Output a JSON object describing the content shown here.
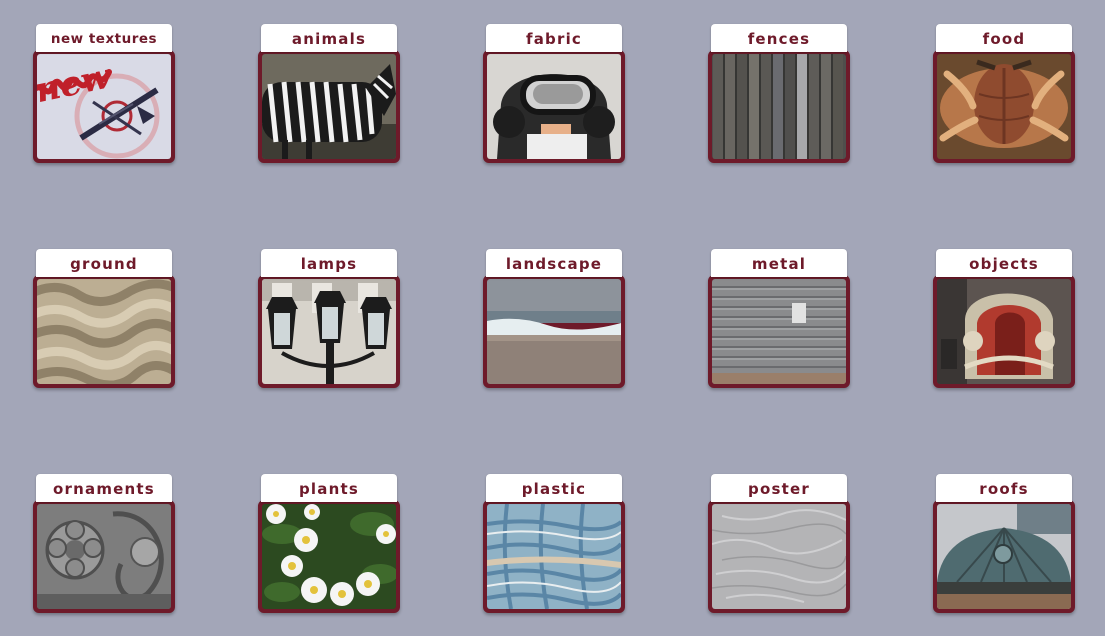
{
  "categories": [
    {
      "id": "new-textures",
      "label": "new textures",
      "badge": "new"
    },
    {
      "id": "animals",
      "label": "animals"
    },
    {
      "id": "fabric",
      "label": "fabric"
    },
    {
      "id": "fences",
      "label": "fences"
    },
    {
      "id": "food",
      "label": "food"
    },
    {
      "id": "ground",
      "label": "ground"
    },
    {
      "id": "lamps",
      "label": "lamps"
    },
    {
      "id": "landscape",
      "label": "landscape"
    },
    {
      "id": "metal",
      "label": "metal"
    },
    {
      "id": "objects",
      "label": "objects"
    },
    {
      "id": "ornaments",
      "label": "ornaments"
    },
    {
      "id": "plants",
      "label": "plants"
    },
    {
      "id": "plastic",
      "label": "plastic"
    },
    {
      "id": "poster",
      "label": "poster"
    },
    {
      "id": "roofs",
      "label": "roofs"
    }
  ],
  "colors": {
    "background": "#a3a6b8",
    "frame": "#6e1a2a",
    "label_text": "#6e1a2a",
    "tab": "#ffffff",
    "badge": "#c0202a"
  }
}
